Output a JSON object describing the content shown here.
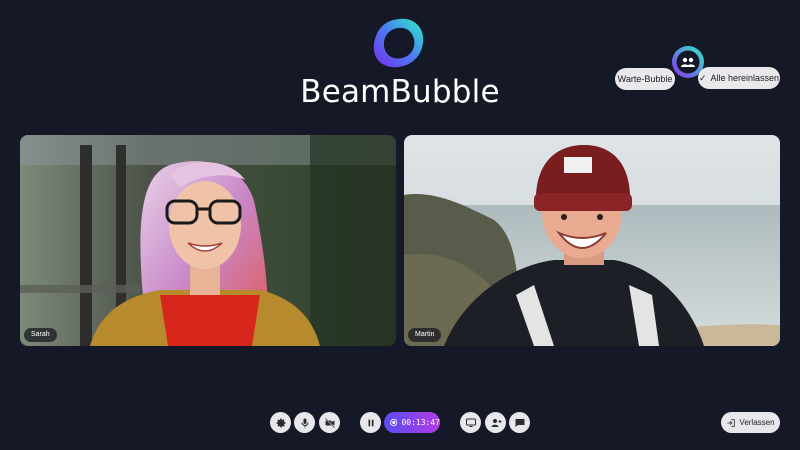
{
  "brand": {
    "name": "BeamBubble",
    "accent_start": "#2ee6d0",
    "accent_end": "#6a3cf0"
  },
  "waiting_room": {
    "label": "Warte-Bubble",
    "admit_all_label": "Alle hereinlassen",
    "icon": "people-icon"
  },
  "participants": [
    {
      "name": "Sarah"
    },
    {
      "name": "Martin"
    }
  ],
  "controls": {
    "settings_icon": "gear-icon",
    "mic_icon": "microphone-icon",
    "camera_icon": "camera-off-icon",
    "pause_icon": "pause-icon",
    "recording_time": "00:13:47",
    "screen_share_icon": "monitor-icon",
    "add_person_icon": "add-person-icon",
    "chat_icon": "chat-icon",
    "leave_label": "Verlassen"
  }
}
